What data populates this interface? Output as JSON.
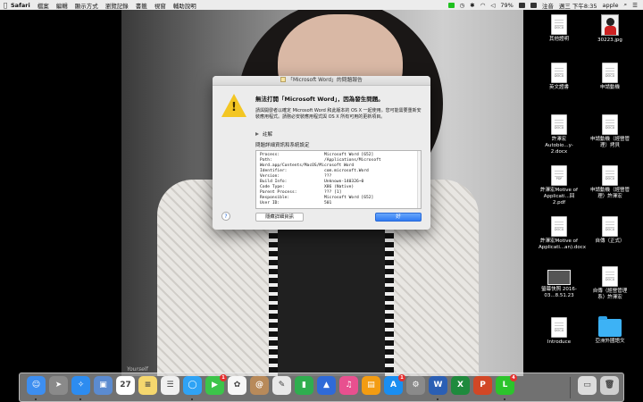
{
  "menubar": {
    "apple_icon": "apple-icon",
    "app_name": "Safari",
    "menus": [
      "檔案",
      "編輯",
      "顯示方式",
      "瀏覽記錄",
      "書籤",
      "視窗",
      "輔助說明"
    ],
    "battery": "79%",
    "input_label": "注音",
    "clock": "週三 下午8:35",
    "user": "apple"
  },
  "wallpaper": {
    "signature": "Yourself"
  },
  "desktop": {
    "files": [
      {
        "label": "其他證明",
        "tag": "DOCX"
      },
      {
        "label": "30223.jpg",
        "tag": ""
      },
      {
        "label": "英文證書",
        "tag": "DOCX"
      },
      {
        "label": "申請動機",
        "tag": "DOCX"
      },
      {
        "label": "許澤宏Autobio...y-2.docx",
        "tag": "DOCX"
      },
      {
        "label": "申請動機（經營管理）拷貝",
        "tag": "DOCX"
      },
      {
        "label": "許澤宏Motive of Applicati...回 2.pdf",
        "tag": "PDF"
      },
      {
        "label": "申請動機（經營管理）許澤宏",
        "tag": "DOCX"
      },
      {
        "label": "許澤宏Motive of Applicati...an).docx",
        "tag": "DOCX"
      },
      {
        "label": "自傳（正式）",
        "tag": "DOCX"
      },
      {
        "label": "螢幕快照 2016-03...8.51.23",
        "tag": ""
      },
      {
        "label": "自傳（經營管理系）許澤宏",
        "tag": "DOCX"
      },
      {
        "label": "Introduce",
        "tag": "DOCX"
      },
      {
        "label": "亞洲外國語文",
        "tag": ""
      }
    ]
  },
  "dialog": {
    "title": "「Microsoft Word」的問題報告",
    "headline": "無法打開「Microsoft Word」，因為發生問題。",
    "description": "請與開發者以確定 Microsoft Word 和此版本的 OS X 一起使用。您可能需要重新安裝應用程式。請務必安裝應用程式與 OS X 所有可用的更新項目。",
    "disclosure": "註解",
    "details_label": "問題詳細資訊和系統設定",
    "report": [
      {
        "k": "Process:",
        "v": "Microsoft Word [652]"
      },
      {
        "k": "Path:",
        "v": "/Applications/Microsoft"
      },
      {
        "k": "Word.app/Contents/MacOS/Microsoft Word",
        "v": ""
      },
      {
        "k": "Identifier:",
        "v": "com.microsoft.Word"
      },
      {
        "k": "Version:",
        "v": "???"
      },
      {
        "k": "Build Info:",
        "v": "Unknown-140326~0"
      },
      {
        "k": "Code Type:",
        "v": "X86 (Native)"
      },
      {
        "k": "Parent Process:",
        "v": "??? [1]"
      },
      {
        "k": "Responsible:",
        "v": "Microsoft Word [652]"
      },
      {
        "k": "User ID:",
        "v": "501"
      }
    ],
    "help": "?",
    "hide_button": "隱藏詳細資訊",
    "ok_button": "好"
  },
  "dock": {
    "apps": [
      {
        "name": "finder-icon",
        "color": "#3d8ef0",
        "glyph": "☺"
      },
      {
        "name": "launchpad-icon",
        "color": "#8a8a8a",
        "glyph": "➤"
      },
      {
        "name": "safari-icon",
        "color": "#2d8cf0",
        "glyph": "✧"
      },
      {
        "name": "preview-icon",
        "color": "#5b8bd0",
        "glyph": "▣"
      },
      {
        "name": "calendar-icon",
        "color": "#ffffff",
        "glyph": "27"
      },
      {
        "name": "notes-icon",
        "color": "#f5d76e",
        "glyph": "≡"
      },
      {
        "name": "reminders-icon",
        "color": "#f0f0f0",
        "glyph": "☰"
      },
      {
        "name": "messages-icon",
        "color": "#2fa3f5",
        "glyph": "◯"
      },
      {
        "name": "facetime-icon",
        "color": "#3cc44a",
        "glyph": "▶"
      },
      {
        "name": "photos-icon",
        "color": "#f7f7f7",
        "glyph": "✿"
      },
      {
        "name": "contacts-icon",
        "color": "#b88a5a",
        "glyph": "@"
      },
      {
        "name": "textedit-icon",
        "color": "#e8e8e8",
        "glyph": "✎"
      },
      {
        "name": "numbers-icon",
        "color": "#2fae4f",
        "glyph": "▮"
      },
      {
        "name": "keynote-icon",
        "color": "#2f6ad8",
        "glyph": "▲"
      },
      {
        "name": "itunes-icon",
        "color": "#e8508f",
        "glyph": "♫"
      },
      {
        "name": "ibooks-icon",
        "color": "#f39c12",
        "glyph": "▤"
      },
      {
        "name": "appstore-icon",
        "color": "#1a8ef0",
        "glyph": "A"
      },
      {
        "name": "system-preferences-icon",
        "color": "#8a8a8a",
        "glyph": "⚙"
      },
      {
        "name": "word-icon",
        "color": "#2b5fb4",
        "glyph": "W"
      },
      {
        "name": "excel-icon",
        "color": "#1f8a3d",
        "glyph": "X"
      },
      {
        "name": "powerpoint-icon",
        "color": "#d24726",
        "glyph": "P"
      },
      {
        "name": "line-icon",
        "color": "#2cc42c",
        "glyph": "L"
      },
      {
        "name": "downloads-folder-icon",
        "color": "#dcdcdc",
        "glyph": "▭"
      },
      {
        "name": "trash-icon",
        "color": "#cfcfcf",
        "glyph": "🗑"
      }
    ],
    "facetime_badge": "1",
    "appstore_badge": "1",
    "line_badge": "4"
  }
}
